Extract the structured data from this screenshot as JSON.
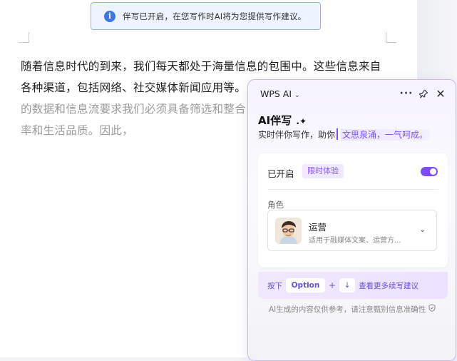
{
  "notice": {
    "text": "伴写已开启，在您写作时AI将为您提供写作建议。"
  },
  "document": {
    "lines": [
      "随着信息时代的到来，我们每天都处于海量信息的包围中。这些信息来自",
      "各种渠道，包括网络、社交媒体新闻应用等。"
    ],
    "faded_lines": [
      "的数据和信息流要求我们必须具备筛选和整合",
      "率和生活品质。因此，"
    ]
  },
  "panel": {
    "title": "WPS AI",
    "ai_title": "AI伴写",
    "ai_subtitle": "实时伴你写作，助你",
    "ai_subtitle_highlight": "文思泉涌，一气呵成。",
    "enabled_label": "已开启",
    "trial_badge": "限时体验",
    "role_label": "角色",
    "role": {
      "name": "运营",
      "description": "适用于融媒体文案、运营方..."
    },
    "hint": {
      "press": "按下",
      "key": "Option",
      "plus": "+",
      "arrow": "↓",
      "action": "查看更多续写建议"
    },
    "disclaimer": "AI生成的内容仅供参考，请注意甄别信息准确性",
    "toggle_on": true
  },
  "colors": {
    "accent": "#7c4dff",
    "notice_border": "#8fb4f5",
    "info": "#3d76e6"
  }
}
